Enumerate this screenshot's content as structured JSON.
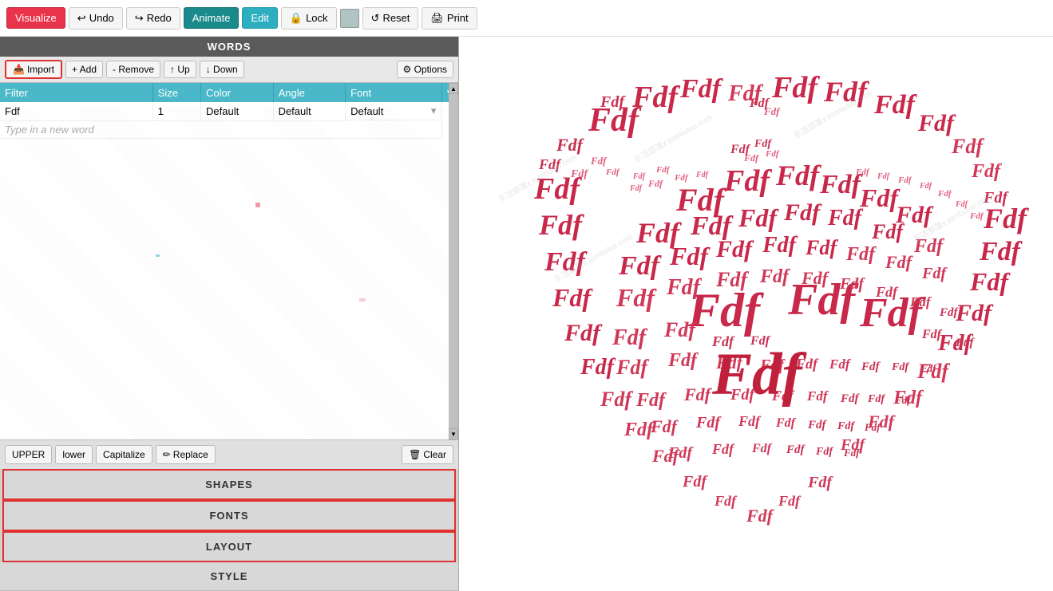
{
  "toolbar": {
    "visualize_label": "Visualize",
    "undo_label": "Undo",
    "redo_label": "Redo",
    "animate_label": "Animate",
    "edit_label": "Edit",
    "lock_label": "Lock",
    "reset_label": "Reset",
    "print_label": "Print"
  },
  "words_panel": {
    "title": "WORDS",
    "import_label": "Import",
    "add_label": "+ Add",
    "remove_label": "- Remove",
    "up_label": "↑ Up",
    "down_label": "↓ Down",
    "options_label": "⚙ Options",
    "columns": [
      "Filter",
      "Size",
      "Color",
      "Angle",
      "Font"
    ],
    "rows": [
      {
        "word": "Fdf",
        "size": "1",
        "color": "Default",
        "angle": "Default",
        "font": "Default"
      }
    ],
    "new_word_placeholder": "Type in a new word",
    "upper_label": "UPPER",
    "lower_label": "lower",
    "capitalize_label": "Capitalize",
    "replace_label": "Replace",
    "clear_label": "Clear"
  },
  "menu_items": [
    {
      "label": "SHAPES"
    },
    {
      "label": "FONTS"
    },
    {
      "label": "LAYOUT"
    },
    {
      "label": "STYLE"
    }
  ]
}
